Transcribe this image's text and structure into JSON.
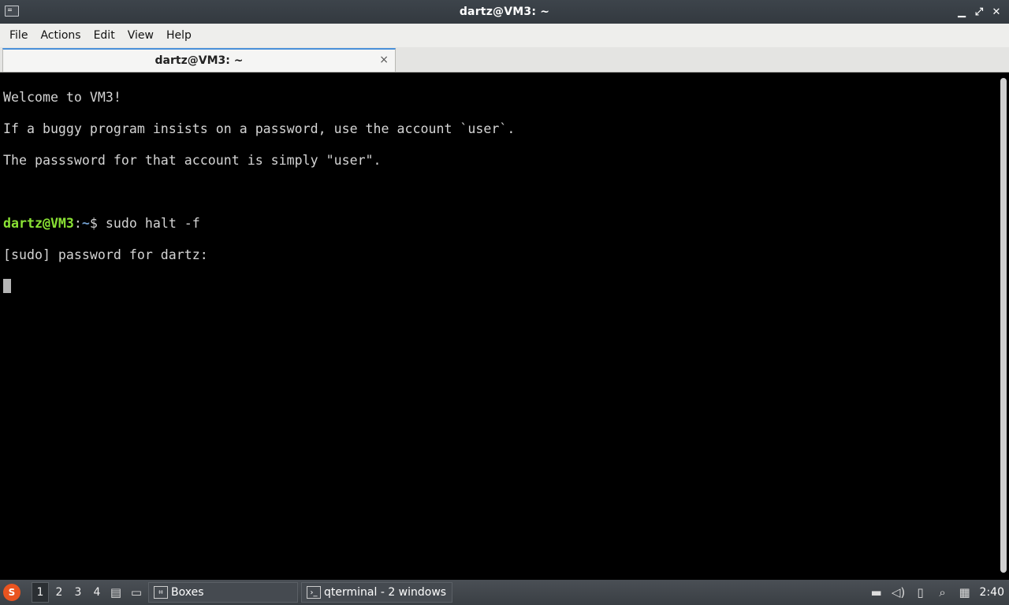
{
  "window": {
    "title": "dartz@VM3: ~"
  },
  "menu": {
    "items": [
      "File",
      "Actions",
      "Edit",
      "View",
      "Help"
    ]
  },
  "tab": {
    "label": "dartz@VM3: ~",
    "close": "×"
  },
  "terminal": {
    "lines": [
      "Welcome to VM3!",
      "If a buggy program insists on a password, use the account `user`.",
      "The passsword for that account is simply \"user\".",
      ""
    ],
    "prompt_user": "dartz@VM3",
    "prompt_sep": ":",
    "prompt_path": "~",
    "prompt_dollar": "$ ",
    "command": "sudo halt -f",
    "sudo_prompt": "[sudo] password for dartz:"
  },
  "taskbar": {
    "desktops": [
      "1",
      "2",
      "3",
      "4"
    ],
    "tasks": [
      {
        "label": "Boxes",
        "icon": "boxes-icon"
      },
      {
        "label": "qterminal - 2 windows",
        "icon": "terminal-icon"
      }
    ],
    "clock": "2:40"
  }
}
